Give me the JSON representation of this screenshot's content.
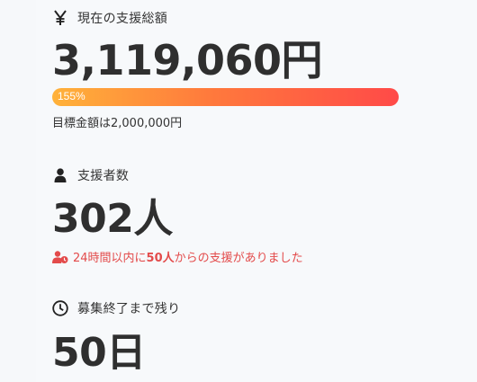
{
  "funding": {
    "icon": "yen-icon",
    "label": "現在の支援総額",
    "amount": "3,119,060円",
    "progress_percent": 155,
    "progress_label": "155%",
    "goal_text": "目標金額は2,000,000円"
  },
  "backers": {
    "icon": "person-icon",
    "label": "支援者数",
    "count": "302人",
    "recent_prefix": "24時間以内に",
    "recent_count": "50人",
    "recent_suffix": "からの支援がありました",
    "recent_icon": "user-clock-icon",
    "recent_color": "#e34b4b"
  },
  "remaining": {
    "icon": "clock-icon",
    "label": "募集終了まで残り",
    "days": "50日"
  }
}
